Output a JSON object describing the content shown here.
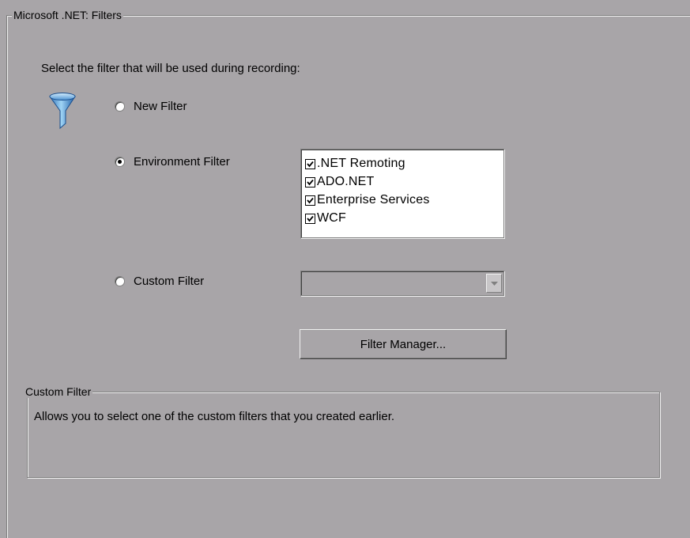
{
  "group_title": "Microsoft .NET: Filters",
  "prompt": "Select the filter that will be used during recording:",
  "icon": "funnel-icon",
  "radios": {
    "new": {
      "label": "New Filter",
      "checked": false
    },
    "environment": {
      "label": "Environment Filter",
      "checked": true
    },
    "custom": {
      "label": "Custom Filter",
      "checked": false
    }
  },
  "environment_filters": [
    {
      "label": ".NET Remoting",
      "checked": true
    },
    {
      "label": "ADO.NET",
      "checked": true
    },
    {
      "label": "Enterprise Services",
      "checked": true
    },
    {
      "label": "WCF",
      "checked": true
    }
  ],
  "custom_filter_select": {
    "value": ""
  },
  "filter_manager_button": "Filter Manager...",
  "description": {
    "title": "Custom Filter",
    "text": "Allows you to select one of the custom filters that you created earlier."
  }
}
